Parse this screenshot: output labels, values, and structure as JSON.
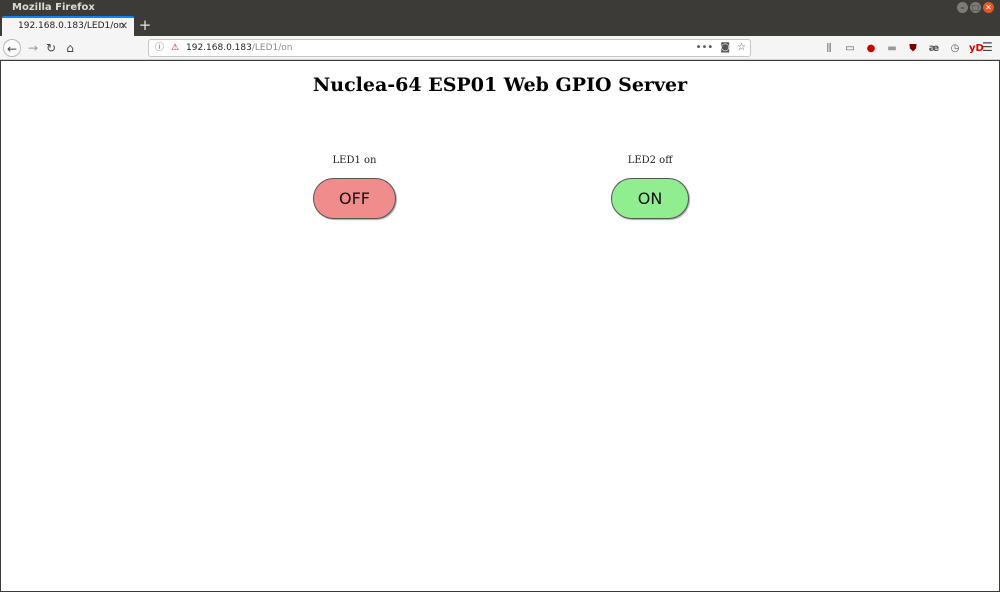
{
  "window": {
    "title": "Mozilla Firefox",
    "controls": [
      "–",
      "□",
      "✕"
    ]
  },
  "tab": {
    "title": "192.168.0.183/LED1/on",
    "close": "✕",
    "new_tab": "+"
  },
  "nav": {
    "url_host": "192.168.0.183",
    "url_path": "/LED1/on"
  },
  "page": {
    "title": "Nuclea-64 ESP01 Web GPIO Server",
    "leds": [
      {
        "label": "LED1 on",
        "button": "OFF",
        "color": "#f08c8c"
      },
      {
        "label": "LED2 off",
        "button": "ON",
        "color": "#90ee90"
      }
    ]
  },
  "colors": {
    "tab_accent": "#0a84ff",
    "close_button": "#e95420"
  }
}
